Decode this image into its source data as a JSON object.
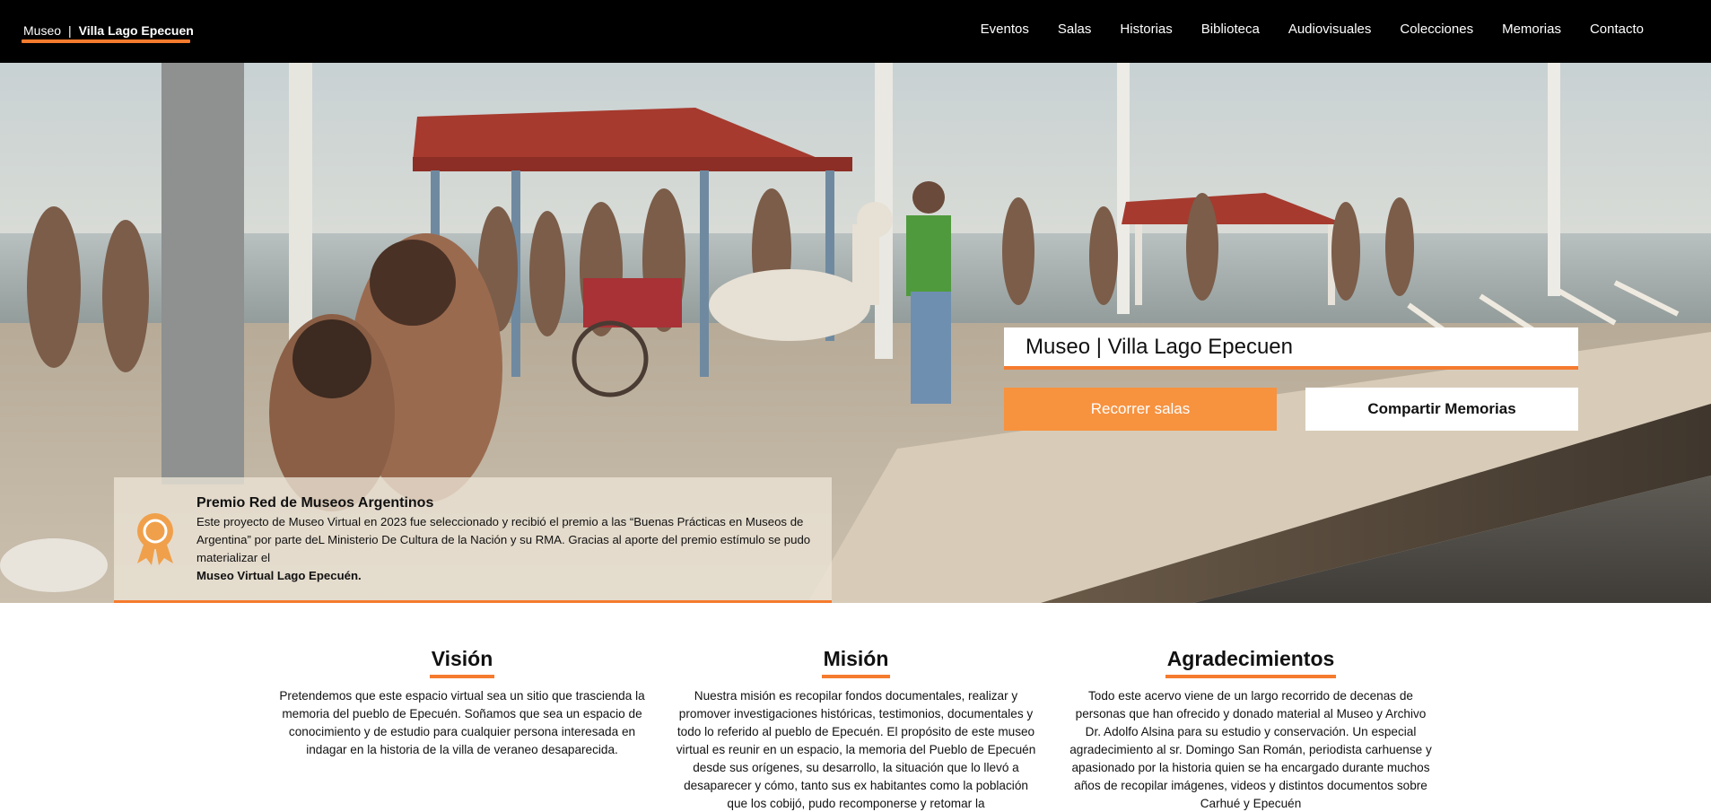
{
  "header": {
    "brand_prefix": "Museo",
    "brand_separator": "|",
    "brand_name": "Villa Lago Epecuen",
    "nav": [
      "Eventos",
      "Salas",
      "Historias",
      "Biblioteca",
      "Audiovisuales",
      "Colecciones",
      "Memorias",
      "Contacto"
    ]
  },
  "hero": {
    "title": "Museo | Villa Lago Epecuen",
    "primary_button": "Recorrer salas",
    "secondary_button": "Compartir Memorias",
    "award": {
      "title": "Premio Red de Museos Argentinos",
      "body": "Este proyecto de Museo Virtual en 2023 fue seleccionado y recibió el premio a las “Buenas Prácticas en Museos de Argentina” por parte deL Ministerio De Cultura de la Nación y su RMA. Gracias al aporte del premio estímulo se pudo materializar el",
      "strong": "Museo Virtual Lago Epecuén."
    }
  },
  "sections": [
    {
      "title": "Visión",
      "text": "Pretendemos que este espacio virtual sea un sitio que trascienda la memoria del pueblo de Epecuén. Soñamos que sea un espacio de conocimiento y de estudio para cualquier persona interesada en indagar en la historia de la villa de veraneo desaparecida."
    },
    {
      "title": "Misión",
      "text": "Nuestra misión es recopilar fondos documentales, realizar y promover investigaciones históricas, testimonios, documentales y todo lo referido al pueblo de Epecuén. El propósito de este museo virtual es reunir en un espacio, la memoria del Pueblo de Epecuén desde sus orígenes, su desarrollo, la situación que lo llevó a desaparecer y cómo, tanto sus ex habitantes como la población que los cobijó, pudo recomponerse y retomar la"
    },
    {
      "title": "Agradecimientos",
      "text": "Todo este acervo viene de un largo recorrido de decenas de personas que han ofrecido y donado material al Museo y Archivo Dr. Adolfo Alsina para su estudio y conservación. Un especial agradecimiento al sr. Domingo San Román, periodista carhuense y apasionado por la historia quien se ha encargado durante muchos años de recopilar imágenes, videos y distintos documentos sobre Carhué y Epecuén"
    }
  ],
  "colors": {
    "accent": "#f57b2e",
    "button_orange": "#f7923f",
    "nav_bg": "#000000"
  },
  "icons": [
    "award-ribbon-icon"
  ]
}
